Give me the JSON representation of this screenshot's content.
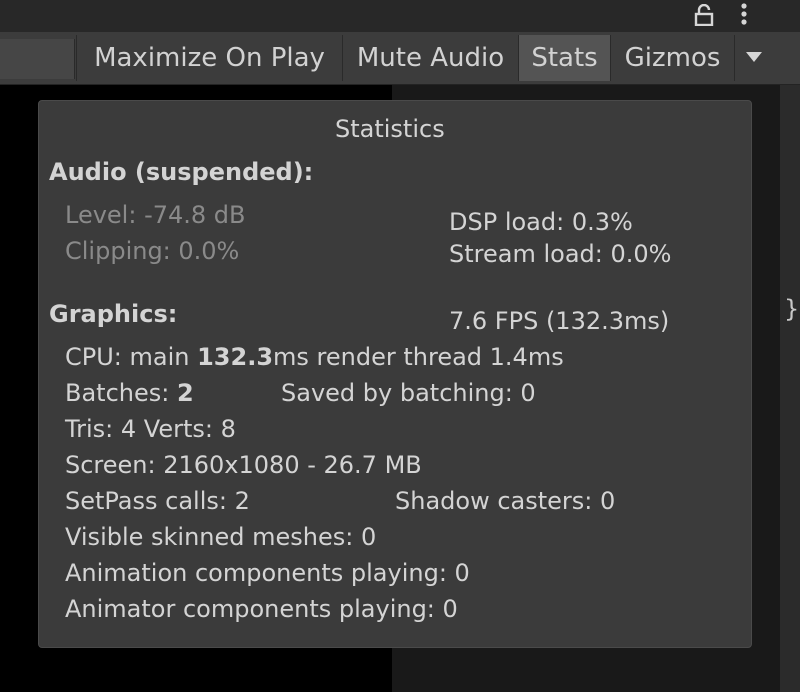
{
  "toolbar": {
    "buttons": [
      {
        "label": "Maximize On Play",
        "active": false
      },
      {
        "label": "Mute Audio",
        "active": false
      },
      {
        "label": "Stats",
        "active": true
      },
      {
        "label": "Gizmos",
        "active": false
      }
    ],
    "dropdown_icon": "triangle-down-icon"
  },
  "header": {
    "icons": [
      "lock-icon",
      "more-vertical-icon"
    ]
  },
  "right_edge_glyph": "}",
  "stats": {
    "title": "Statistics",
    "audio": {
      "heading": "Audio (suspended):",
      "level": "Level: -74.8 dB",
      "clipping": "Clipping: 0.0%",
      "dsp_load": "DSP load: 0.3%",
      "stream_load": "Stream load: 0.0%"
    },
    "graphics": {
      "heading": "Graphics:",
      "fps": "7.6 FPS (132.3ms)",
      "cpu_prefix": "CPU: main ",
      "cpu_main_value": "132.3",
      "cpu_suffix": "ms  render thread 1.4ms",
      "batches_prefix": "Batches: ",
      "batches_value": "2",
      "saved_by_batching": "Saved by batching: 0",
      "tris_verts": "Tris: 4   Verts: 8",
      "screen": "Screen: 2160x1080 - 26.7 MB",
      "setpass": "SetPass calls: 2",
      "shadow_casters": "Shadow casters: 0",
      "skinned_meshes": "Visible skinned meshes: 0",
      "animation_components": "Animation components playing: 0",
      "animator_components": "Animator components playing: 0"
    }
  },
  "colors": {
    "panel_bg": "#3b3b3b",
    "toolbar_bg": "#3c3c3c",
    "active_button_bg": "#545454",
    "text": "#d4d4d4",
    "dim_text": "#8a8a8a",
    "game_view_bg": "#000000"
  }
}
